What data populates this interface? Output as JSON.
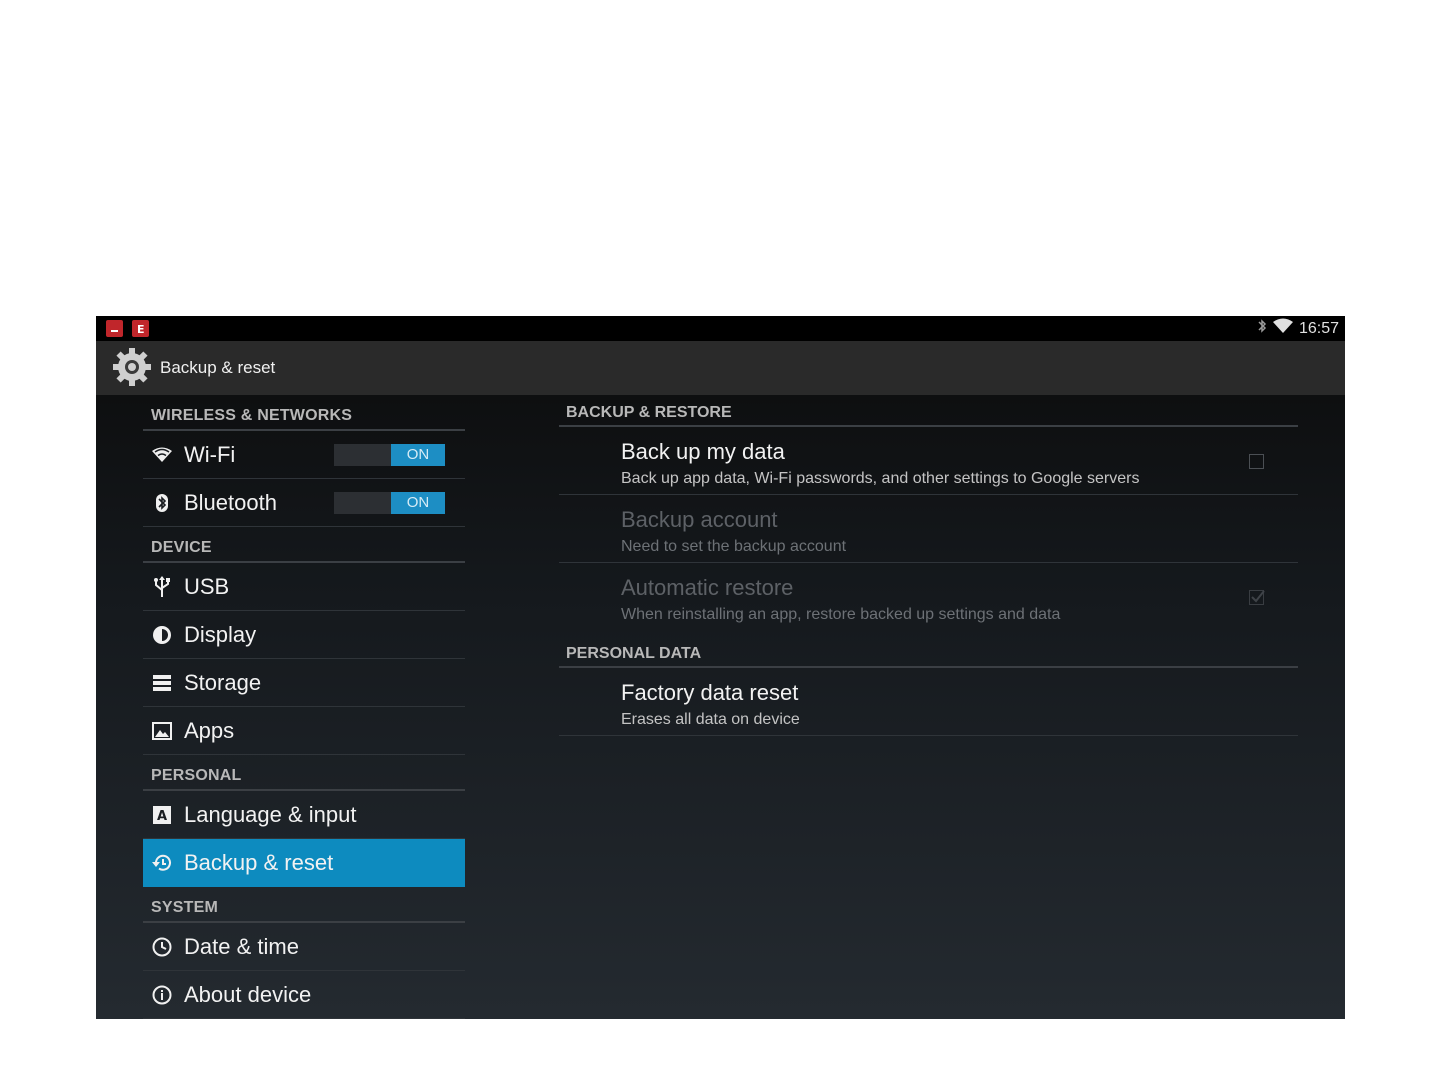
{
  "statusbar": {
    "time": "16:57",
    "icons": [
      "notification-red-icon",
      "notification-e-icon",
      "bluetooth-icon",
      "wifi-icon"
    ]
  },
  "actionbar": {
    "title": "Backup & reset",
    "icon": "settings-gear-icon"
  },
  "left_nav": {
    "sections": {
      "wireless": "WIRELESS & NETWORKS",
      "device": "DEVICE",
      "personal": "PERSONAL",
      "system": "SYSTEM"
    },
    "items": {
      "wifi": {
        "label": "Wi-Fi",
        "icon": "wifi-icon",
        "toggle": "ON"
      },
      "bluetooth": {
        "label": "Bluetooth",
        "icon": "bluetooth-icon",
        "toggle": "ON"
      },
      "usb": {
        "label": "USB",
        "icon": "usb-icon"
      },
      "display": {
        "label": "Display",
        "icon": "brightness-icon"
      },
      "storage": {
        "label": "Storage",
        "icon": "storage-icon"
      },
      "apps": {
        "label": "Apps",
        "icon": "apps-icon"
      },
      "language": {
        "label": "Language & input",
        "icon": "keyboard-a-icon"
      },
      "backup": {
        "label": "Backup & reset",
        "icon": "restore-icon",
        "selected": true
      },
      "datetime": {
        "label": "Date & time",
        "icon": "clock-icon"
      },
      "about": {
        "label": "About device",
        "icon": "info-icon"
      }
    }
  },
  "right_pane": {
    "sections": {
      "backup_restore": "BACKUP & RESTORE",
      "personal_data": "PERSONAL DATA"
    },
    "items": {
      "backup_data": {
        "title": "Back up my data",
        "summary": "Back up app data, Wi-Fi passwords, and other settings to Google servers",
        "checked": false
      },
      "backup_account": {
        "title": "Backup account",
        "summary": "Need to set the backup account",
        "enabled": false
      },
      "auto_restore": {
        "title": "Automatic restore",
        "summary": "When reinstalling an app, restore backed up settings and data",
        "checked": true,
        "enabled": false
      },
      "factory_reset": {
        "title": "Factory data reset",
        "summary": "Erases all data on device"
      }
    }
  },
  "colors": {
    "accent": "#0d8bbf",
    "toggle_on": "#1d8ec4",
    "statusbar": "#000000",
    "actionbar": "#2a2a2a"
  }
}
